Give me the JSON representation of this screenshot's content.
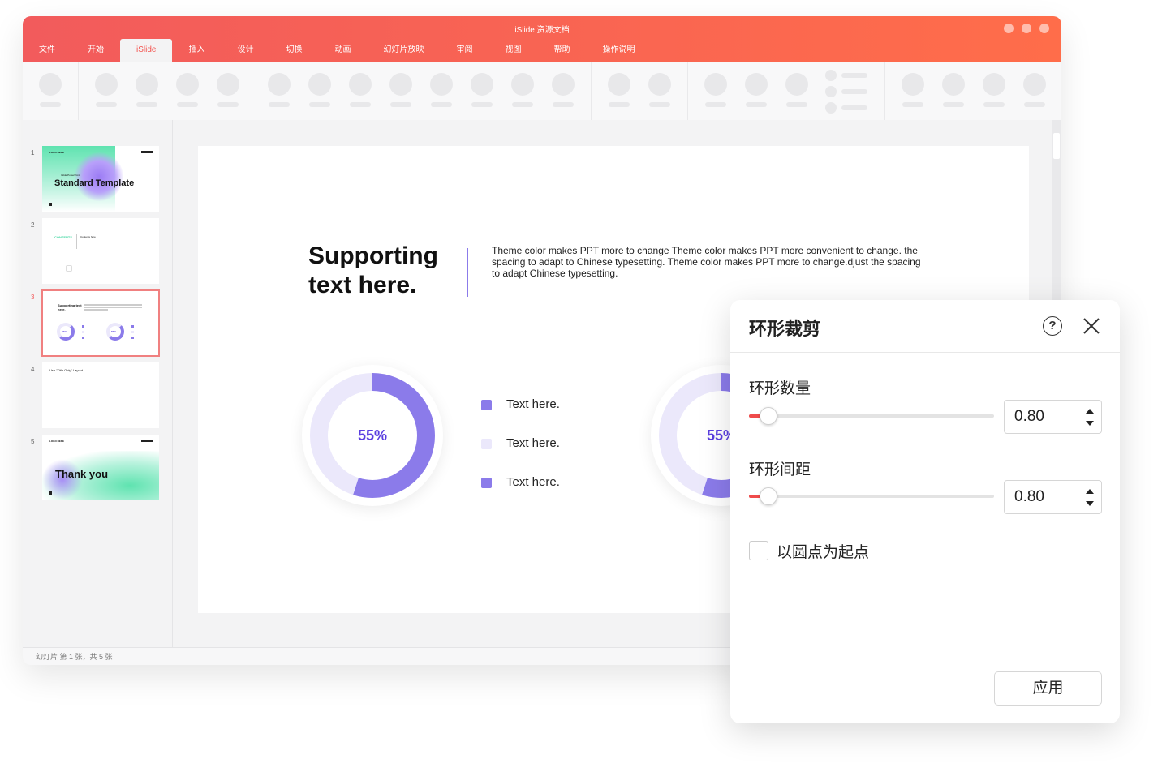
{
  "window": {
    "title": "iSlide 资源文档",
    "tabs": [
      "文件",
      "开始",
      "iSlide",
      "插入",
      "设计",
      "切换",
      "动画",
      "幻灯片放映",
      "审阅",
      "视图",
      "帮助",
      "操作说明"
    ],
    "active_tab": "iSlide",
    "accent": "#f25b5c"
  },
  "thumbnails": [
    {
      "num": "1",
      "logo": "LOGO HERE",
      "subtitle": "iSlide PowerPoint",
      "title": "Standard Template"
    },
    {
      "num": "2",
      "label": "CONTENTS",
      "sub": "Contents here"
    },
    {
      "num": "3",
      "title": "Supporting text here.",
      "pct": "55%"
    },
    {
      "num": "4",
      "title": "Use \"Title Only\" Layout"
    },
    {
      "num": "5",
      "logo": "LOGO HERE",
      "title": "Thank you"
    }
  ],
  "selected_slide": 3,
  "status": {
    "text": "幻灯片 第 1 张，共 5 张"
  },
  "slide": {
    "title": "Supporting text here.",
    "title_line1": "Supporting",
    "title_line2": "text here.",
    "body": "Theme color makes PPT more to change Theme color makes PPT more convenient to change. the spacing to adapt to Chinese typesetting. Theme color makes PPT more to change.djust the spacing to adapt Chinese typesetting.",
    "donut1": {
      "percent": 55,
      "label": "55%"
    },
    "donut2": {
      "percent": 55,
      "label": "55%"
    },
    "legend": [
      {
        "text": "Text here.",
        "color": "#8b7bea"
      },
      {
        "text": "Text here.",
        "color": "#ebe8fb"
      },
      {
        "text": "Text here.",
        "color": "#8b7bea"
      }
    ]
  },
  "dialog": {
    "title": "环形裁剪",
    "help_icon": "?",
    "ring_count": {
      "label": "环形数量",
      "value": "0.80",
      "slider_fraction": 0.08
    },
    "ring_spacing": {
      "label": "环形间距",
      "value": "0.80",
      "slider_fraction": 0.08
    },
    "start_from_dot": {
      "label": "以圆点为起点",
      "checked": false
    },
    "apply_label": "应用"
  }
}
